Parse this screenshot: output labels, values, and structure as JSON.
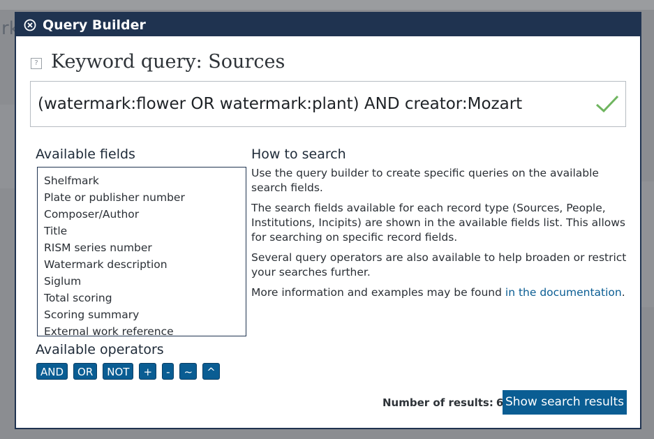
{
  "modal": {
    "title": "Query Builder",
    "heading": "Keyword query: Sources"
  },
  "query": {
    "value": "(watermark:flower OR watermark:plant) AND creator:Mozart"
  },
  "fields": {
    "heading": "Available fields",
    "items": [
      "Shelfmark",
      "Plate or publisher number",
      "Composer/Author",
      "Title",
      "RISM series number",
      "Watermark description",
      "Siglum",
      "Total scoring",
      "Scoring summary",
      "External work reference"
    ]
  },
  "operators": {
    "heading": "Available operators",
    "items": [
      "AND",
      "OR",
      "NOT",
      "+",
      "-",
      "~",
      "^"
    ]
  },
  "help": {
    "heading": "How to search",
    "p1": "Use the query builder to create specific queries on the available search fields.",
    "p2": "The search fields available for each record type (Sources, People, Institutions, Incipits) are shown in the available fields list. This allows for searching on specific record fields.",
    "p3": "Several query operators are also available to help broaden or restrict your searches further.",
    "p4_prefix": "More information and examples may be found ",
    "p4_link": "in the documentation",
    "p4_suffix": "."
  },
  "results": {
    "label": "Number of results:",
    "count": "6",
    "button": "Show search results"
  },
  "background": {
    "fragment_text": "rk"
  },
  "colors": {
    "header_bg": "#1f3350",
    "accent": "#0a5d93",
    "check": "#6fb55f"
  },
  "icons": {
    "close": "close-circle-icon",
    "help": "help-square-icon",
    "valid": "checkmark-icon"
  }
}
